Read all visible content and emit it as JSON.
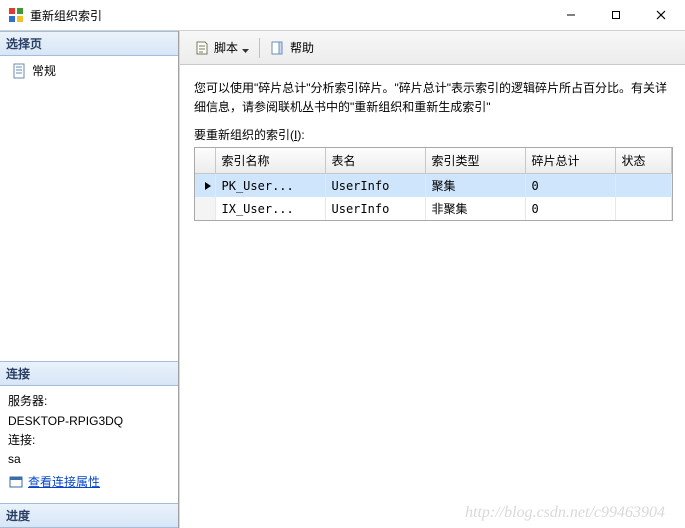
{
  "window": {
    "title": "重新组织索引"
  },
  "sidebar": {
    "select_header": "选择页",
    "items": [
      {
        "label": "常规"
      }
    ],
    "connection_header": "连接",
    "server_label": "服务器:",
    "server_value": "DESKTOP-RPIG3DQ",
    "conn_label": "连接:",
    "conn_value": "sa",
    "view_props": "查看连接属性",
    "progress_header": "进度"
  },
  "toolbar": {
    "script": "脚本",
    "help": "帮助"
  },
  "main": {
    "description": "您可以使用\"碎片总计\"分析索引碎片。\"碎片总计\"表示索引的逻辑碎片所占百分比。有关详细信息，请参阅联机丛书中的\"重新组织和重新生成索引\"",
    "table_label_pre": "要重新组织的索引(",
    "table_label_u": "I",
    "table_label_post": "):",
    "columns": {
      "name": "索引名称",
      "table": "表名",
      "type": "索引类型",
      "frag": "碎片总计",
      "status": "状态"
    },
    "rows": [
      {
        "name": "PK_User...",
        "table": "UserInfo",
        "type": "聚集",
        "frag": "0",
        "status": "",
        "selected": true
      },
      {
        "name": "IX_User...",
        "table": "UserInfo",
        "type": "非聚集",
        "frag": "0",
        "status": "",
        "selected": false
      }
    ]
  },
  "watermark": "http://blog.csdn.net/c99463904"
}
